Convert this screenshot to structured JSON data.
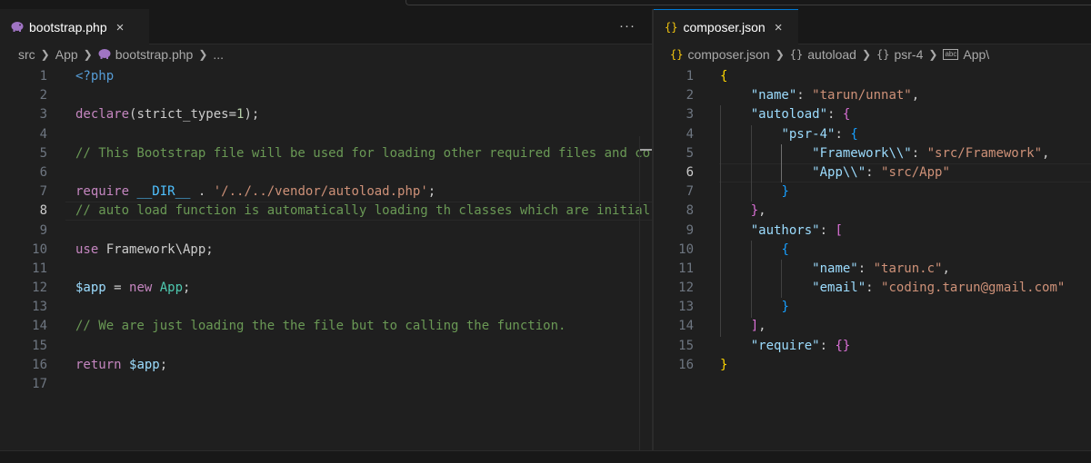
{
  "left_pane": {
    "tab": {
      "label": "bootstrap.php",
      "icon": "php-elephant-icon",
      "close": "×"
    },
    "more_actions": "···",
    "breadcrumb": [
      "src",
      "App",
      "bootstrap.php",
      "..."
    ],
    "current_line": 8,
    "lines": [
      [
        {
          "t": "<?php",
          "c": "tag"
        }
      ],
      [],
      [
        {
          "t": "declare",
          "c": "kw"
        },
        {
          "t": "(",
          "c": "def"
        },
        {
          "t": "strict_types",
          "c": "def"
        },
        {
          "t": "=",
          "c": "def"
        },
        {
          "t": "1",
          "c": "num"
        },
        {
          "t": ");",
          "c": "def"
        }
      ],
      [],
      [
        {
          "t": "// This Bootstrap file will be used for loading other required files and co",
          "c": "cm"
        }
      ],
      [],
      [
        {
          "t": "require ",
          "c": "kw"
        },
        {
          "t": "__DIR__",
          "c": "const"
        },
        {
          "t": " . ",
          "c": "def"
        },
        {
          "t": "'/../../vendor/autoload.php'",
          "c": "str"
        },
        {
          "t": ";",
          "c": "def"
        }
      ],
      [
        {
          "t": "// auto load function is automatically loading th classes which are initial",
          "c": "cm"
        }
      ],
      [],
      [
        {
          "t": "use ",
          "c": "kw"
        },
        {
          "t": "Framework\\App",
          "c": "def"
        },
        {
          "t": ";",
          "c": "def"
        }
      ],
      [],
      [
        {
          "t": "$app",
          "c": "var"
        },
        {
          "t": " = ",
          "c": "def"
        },
        {
          "t": "new ",
          "c": "kw"
        },
        {
          "t": "App",
          "c": "cls"
        },
        {
          "t": ";",
          "c": "def"
        }
      ],
      [],
      [
        {
          "t": "// We are just loading the the file but to calling the function.",
          "c": "cm"
        }
      ],
      [],
      [
        {
          "t": "return ",
          "c": "kw"
        },
        {
          "t": "$app",
          "c": "var"
        },
        {
          "t": ";",
          "c": "def"
        }
      ],
      []
    ]
  },
  "right_pane": {
    "tab": {
      "label": "composer.json",
      "icon": "{}",
      "close": "×"
    },
    "breadcrumb": [
      {
        "icon": "{}",
        "label": "composer.json"
      },
      {
        "icon": "{}",
        "label": "autoload"
      },
      {
        "icon": "{}",
        "label": "psr-4"
      },
      {
        "icon": "abc",
        "label": "App\\"
      }
    ],
    "current_line": 6,
    "lines": [
      [
        {
          "t": "{",
          "c": "b1"
        }
      ],
      [
        {
          "t": "    ",
          "c": "def"
        },
        {
          "t": "\"name\"",
          "c": "key"
        },
        {
          "t": ": ",
          "c": "def"
        },
        {
          "t": "\"tarun/unnat\"",
          "c": "str"
        },
        {
          "t": ",",
          "c": "def"
        }
      ],
      [
        {
          "t": "    ",
          "c": "def"
        },
        {
          "t": "\"autoload\"",
          "c": "key"
        },
        {
          "t": ": ",
          "c": "def"
        },
        {
          "t": "{",
          "c": "b2"
        }
      ],
      [
        {
          "t": "        ",
          "c": "def"
        },
        {
          "t": "\"psr-4\"",
          "c": "key"
        },
        {
          "t": ": ",
          "c": "def"
        },
        {
          "t": "{",
          "c": "b3"
        }
      ],
      [
        {
          "t": "            ",
          "c": "def"
        },
        {
          "t": "\"Framework\\\\\"",
          "c": "key"
        },
        {
          "t": ": ",
          "c": "def"
        },
        {
          "t": "\"src/Framework\"",
          "c": "str"
        },
        {
          "t": ",",
          "c": "def"
        }
      ],
      [
        {
          "t": "            ",
          "c": "def"
        },
        {
          "t": "\"App\\\\\"",
          "c": "key"
        },
        {
          "t": ": ",
          "c": "def"
        },
        {
          "t": "\"src/App\"",
          "c": "str"
        }
      ],
      [
        {
          "t": "        ",
          "c": "def"
        },
        {
          "t": "}",
          "c": "b3"
        }
      ],
      [
        {
          "t": "    ",
          "c": "def"
        },
        {
          "t": "}",
          "c": "b2"
        },
        {
          "t": ",",
          "c": "def"
        }
      ],
      [
        {
          "t": "    ",
          "c": "def"
        },
        {
          "t": "\"authors\"",
          "c": "key"
        },
        {
          "t": ": ",
          "c": "def"
        },
        {
          "t": "[",
          "c": "b2"
        }
      ],
      [
        {
          "t": "        ",
          "c": "def"
        },
        {
          "t": "{",
          "c": "b3"
        }
      ],
      [
        {
          "t": "            ",
          "c": "def"
        },
        {
          "t": "\"name\"",
          "c": "key"
        },
        {
          "t": ": ",
          "c": "def"
        },
        {
          "t": "\"tarun.c\"",
          "c": "str"
        },
        {
          "t": ",",
          "c": "def"
        }
      ],
      [
        {
          "t": "            ",
          "c": "def"
        },
        {
          "t": "\"email\"",
          "c": "key"
        },
        {
          "t": ": ",
          "c": "def"
        },
        {
          "t": "\"coding.tarun@gmail.com\"",
          "c": "str"
        }
      ],
      [
        {
          "t": "        ",
          "c": "def"
        },
        {
          "t": "}",
          "c": "b3"
        }
      ],
      [
        {
          "t": "    ",
          "c": "def"
        },
        {
          "t": "]",
          "c": "b2"
        },
        {
          "t": ",",
          "c": "def"
        }
      ],
      [
        {
          "t": "    ",
          "c": "def"
        },
        {
          "t": "\"require\"",
          "c": "key"
        },
        {
          "t": ": ",
          "c": "def"
        },
        {
          "t": "{}",
          "c": "b2"
        }
      ],
      [
        {
          "t": "}",
          "c": "b1"
        }
      ]
    ]
  },
  "colors": {
    "background": "#1f1f1f",
    "accent": "#0078d4",
    "php_icon": "#a074c4",
    "json_icon": "#f1c40f"
  }
}
